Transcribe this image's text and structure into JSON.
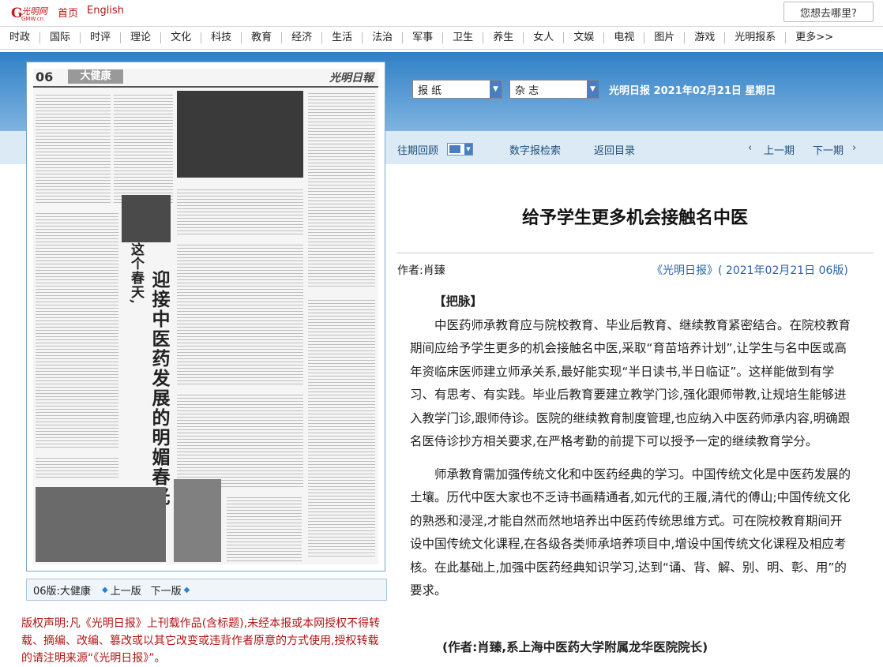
{
  "top": {
    "logo_text": "光明网",
    "home": "首页",
    "english": "English",
    "search_placeholder": "您想去哪里?"
  },
  "nav": [
    "时政",
    "国际",
    "时评",
    "理论",
    "文化",
    "科技",
    "教育",
    "经济",
    "生活",
    "法治",
    "军事",
    "卫生",
    "养生",
    "女人",
    "文娱",
    "电视",
    "图片",
    "游戏",
    "光明报系",
    "更多>>"
  ],
  "paper_preview": {
    "page_number": "06",
    "section": "大健康",
    "masthead": "光明日報",
    "headline": "迎接中医药发展的明媚春光",
    "kicker": "这个春天,"
  },
  "pager": {
    "page_label": "06版:大健康",
    "prev": "上一版",
    "next": "下一版"
  },
  "copyright": "版权声明:凡《光明日报》上刊载作品(含标题),未经本报或本网授权不得转载、摘编、改编、篡改或以其它改变或违背作者原意的方式使用,授权转载的请注明来源“《光明日报》”。",
  "selectors": {
    "paper": "报 纸",
    "magazine": "杂 志",
    "date_line": "光明日报 2021年02月21日 星期日"
  },
  "toolbar": {
    "archive": "往期回顾",
    "search": "数字报检索",
    "back": "返回目录",
    "prev": "上一期",
    "next": "下一期"
  },
  "article": {
    "title": "给予学生更多机会接触名中医",
    "author": "作者:肖臻",
    "source": "《光明日报》( 2021年02月21日 06版)",
    "subhead": "【把脉】",
    "para1": "中医药师承教育应与院校教育、毕业后教育、继续教育紧密结合。在院校教育期间应给予学生更多的机会接触名中医,采取“育苗培养计划”,让学生与名中医或高年资临床医师建立师承关系,最好能实现“半日读书,半日临证”。这样能做到有学习、有思考、有实践。毕业后教育要建立教学门诊,强化跟师带教,让规培生能够进入教学门诊,跟师侍诊。医院的继续教育制度管理,也应纳入中医药师承内容,明确跟名医侍诊抄方相关要求,在严格考勤的前提下可以授予一定的继续教育学分。",
    "para2": "师承教育需加强传统文化和中医药经典的学习。中国传统文化是中医药发展的土壤。历代中医大家也不乏诗书画精通者,如元代的王履,清代的傅山;中国传统文化的熟悉和浸淫,才能自然而然地培养出中医药传统思维方式。可在院校教育期间开设中国传统文化课程,在各级各类师承培养项目中,增设中国传统文化课程及相应考核。在此基础上,加强中医药经典知识学习,达到“诵、背、解、别、明、彰、用”的要求。",
    "signature": "(作者:肖臻,系上海中医药大学附属龙华医院院长)"
  }
}
